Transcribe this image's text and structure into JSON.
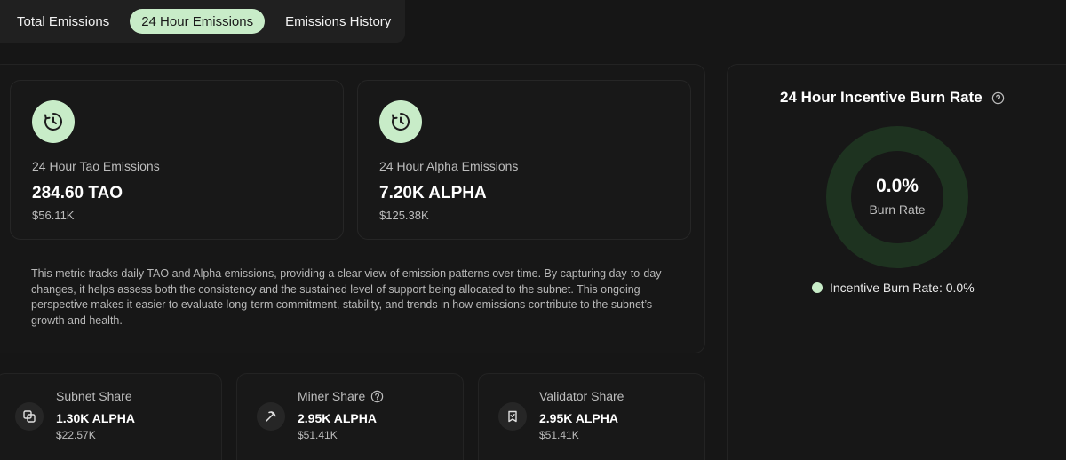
{
  "tabs": [
    {
      "label": "Total Emissions",
      "active": false
    },
    {
      "label": "24 Hour Emissions",
      "active": true
    },
    {
      "label": "Emissions History",
      "active": false
    }
  ],
  "tao_card": {
    "icon": "clock-icon",
    "label": "24 Hour Tao Emissions",
    "value": "284.60 TAO",
    "usd": "$56.11K"
  },
  "alpha_card": {
    "icon": "clock-icon",
    "label": "24 Hour Alpha Emissions",
    "value": "7.20K ALPHA",
    "usd": "$125.38K"
  },
  "description": "This metric tracks daily TAO and Alpha emissions, providing a clear view of emission patterns over time. By capturing day-to-day changes, it helps assess both the consistency and the sustained level of support being allocated to the subnet. This ongoing perspective makes it easier to evaluate long-term commitment, stability, and trends in how emissions contribute to the subnet’s growth and health.",
  "shares": [
    {
      "icon": "subnet-icon",
      "label": "Subnet Share",
      "value": "1.30K ALPHA",
      "usd": "$22.57K"
    },
    {
      "icon": "pickaxe-icon",
      "label": "Miner Share",
      "value": "2.95K ALPHA",
      "usd": "$51.41K",
      "help": true
    },
    {
      "icon": "bookmark-icon",
      "label": "Validator Share",
      "value": "2.95K ALPHA",
      "usd": "$51.41K"
    }
  ],
  "burn": {
    "title": "24 Hour Incentive Burn Rate",
    "value": "0.0%",
    "value_label": "Burn Rate",
    "burn_fraction": 0.0,
    "legend": "Incentive Burn Rate: 0.0%",
    "ring_color": "#1e3320",
    "accent_color": "#c8ecc8"
  }
}
